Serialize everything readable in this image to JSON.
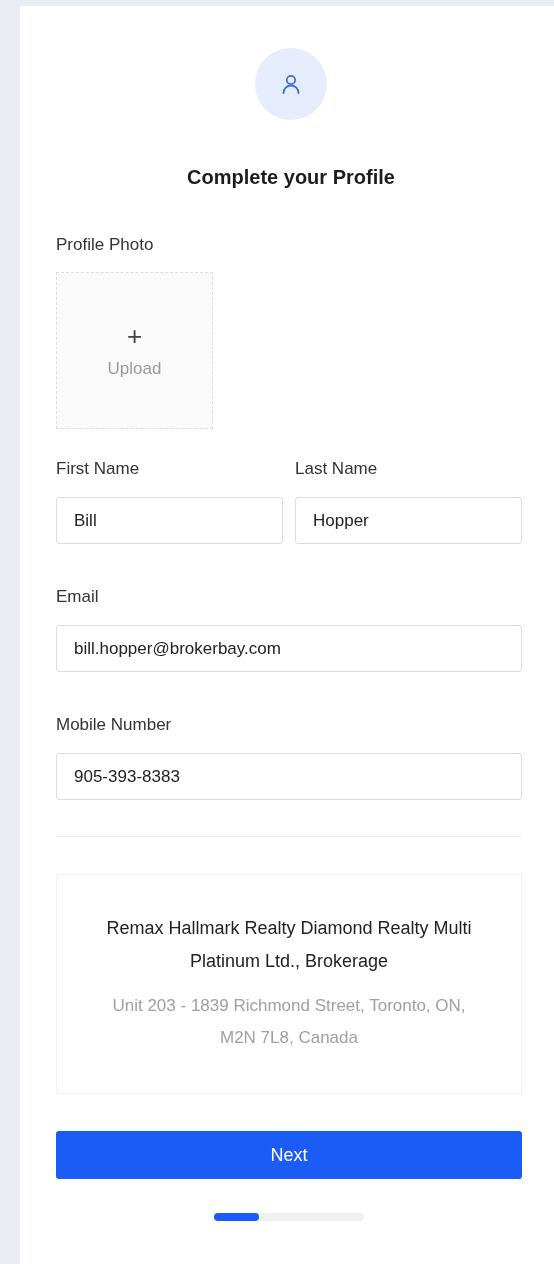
{
  "title": "Complete your Profile",
  "photo": {
    "label": "Profile Photo",
    "plus": "+",
    "upload": "Upload"
  },
  "fields": [
    {
      "label": "First Name",
      "value": "Bill"
    },
    {
      "label": "Last Name",
      "value": "Hopper"
    },
    {
      "label": "Email",
      "value": "bill.hopper@brokerbay.com"
    },
    {
      "label": "Mobile Number",
      "value": "905-393-8383"
    }
  ],
  "brokerage": {
    "name": "Remax Hallmark Realty Diamond Realty Multi Platinum Ltd., Brokerage",
    "address": "Unit 203 - 1839 Richmond Street, Toronto, ON, M2N 7L8, Canada"
  },
  "button": "Next",
  "progress": {
    "level": 0.3
  }
}
